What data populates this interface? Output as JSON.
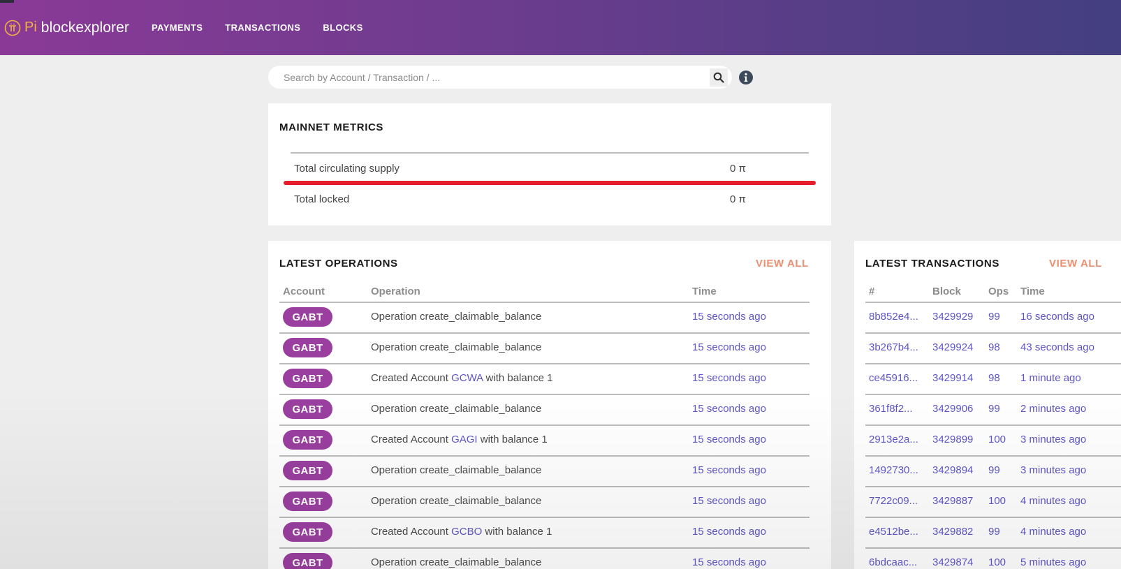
{
  "header": {
    "logo_pi": "Pi",
    "logo_text": "blockexplorer",
    "nav": [
      "PAYMENTS",
      "TRANSACTIONS",
      "BLOCKS"
    ],
    "gradient_colors": [
      "#8a3a96",
      "#433f80"
    ]
  },
  "search": {
    "placeholder": "Search by Account / Transaction / ...",
    "icon": "search-icon",
    "info_icon": "info-icon"
  },
  "metrics": {
    "title": "MAINNET METRICS",
    "rows": [
      {
        "label": "Total circulating supply",
        "value": "0 π"
      },
      {
        "label": "Total locked",
        "value": "0 π"
      }
    ],
    "highlight_color": "#e61e2a"
  },
  "operations": {
    "title": "LATEST OPERATIONS",
    "view_all": "VIEW ALL",
    "columns": [
      "Account",
      "Operation",
      "Time"
    ],
    "rows": [
      {
        "account": "GABT",
        "pre": "Operation create_claimable_balance",
        "link": "",
        "post": "",
        "time": "15 seconds ago"
      },
      {
        "account": "GABT",
        "pre": "Operation create_claimable_balance",
        "link": "",
        "post": "",
        "time": "15 seconds ago"
      },
      {
        "account": "GABT",
        "pre": "Created Account ",
        "link": "GCWA",
        "post": " with balance 1",
        "time": "15 seconds ago"
      },
      {
        "account": "GABT",
        "pre": "Operation create_claimable_balance",
        "link": "",
        "post": "",
        "time": "15 seconds ago"
      },
      {
        "account": "GABT",
        "pre": "Created Account ",
        "link": "GAGI",
        "post": " with balance 1",
        "time": "15 seconds ago"
      },
      {
        "account": "GABT",
        "pre": "Operation create_claimable_balance",
        "link": "",
        "post": "",
        "time": "15 seconds ago"
      },
      {
        "account": "GABT",
        "pre": "Operation create_claimable_balance",
        "link": "",
        "post": "",
        "time": "15 seconds ago"
      },
      {
        "account": "GABT",
        "pre": "Created Account ",
        "link": "GCBO",
        "post": " with balance 1",
        "time": "15 seconds ago"
      },
      {
        "account": "GABT",
        "pre": "Operation create_claimable_balance",
        "link": "",
        "post": "",
        "time": "15 seconds ago"
      }
    ]
  },
  "transactions": {
    "title": "LATEST TRANSACTIONS",
    "view_all": "VIEW ALL",
    "columns": [
      "#",
      "Block",
      "Ops",
      "Time"
    ],
    "rows": [
      {
        "hash": "8b852e4...",
        "block": "3429929",
        "ops": "99",
        "time": "16 seconds ago"
      },
      {
        "hash": "3b267b4...",
        "block": "3429924",
        "ops": "98",
        "time": "43 seconds ago"
      },
      {
        "hash": "ce45916...",
        "block": "3429914",
        "ops": "98",
        "time": "1 minute ago"
      },
      {
        "hash": "361f8f2...",
        "block": "3429906",
        "ops": "99",
        "time": "2 minutes ago"
      },
      {
        "hash": "2913e2a...",
        "block": "3429899",
        "ops": "100",
        "time": "3 minutes ago"
      },
      {
        "hash": "1492730...",
        "block": "3429894",
        "ops": "99",
        "time": "3 minutes ago"
      },
      {
        "hash": "7722c09...",
        "block": "3429887",
        "ops": "100",
        "time": "4 minutes ago"
      },
      {
        "hash": "e4512be...",
        "block": "3429882",
        "ops": "99",
        "time": "4 minutes ago"
      },
      {
        "hash": "6bdcaac...",
        "block": "3429874",
        "ops": "100",
        "time": "5 minutes ago"
      }
    ]
  },
  "colors": {
    "badge": "#9a3fa0",
    "link": "#5e56c8",
    "view_all": "#ec8f70"
  }
}
